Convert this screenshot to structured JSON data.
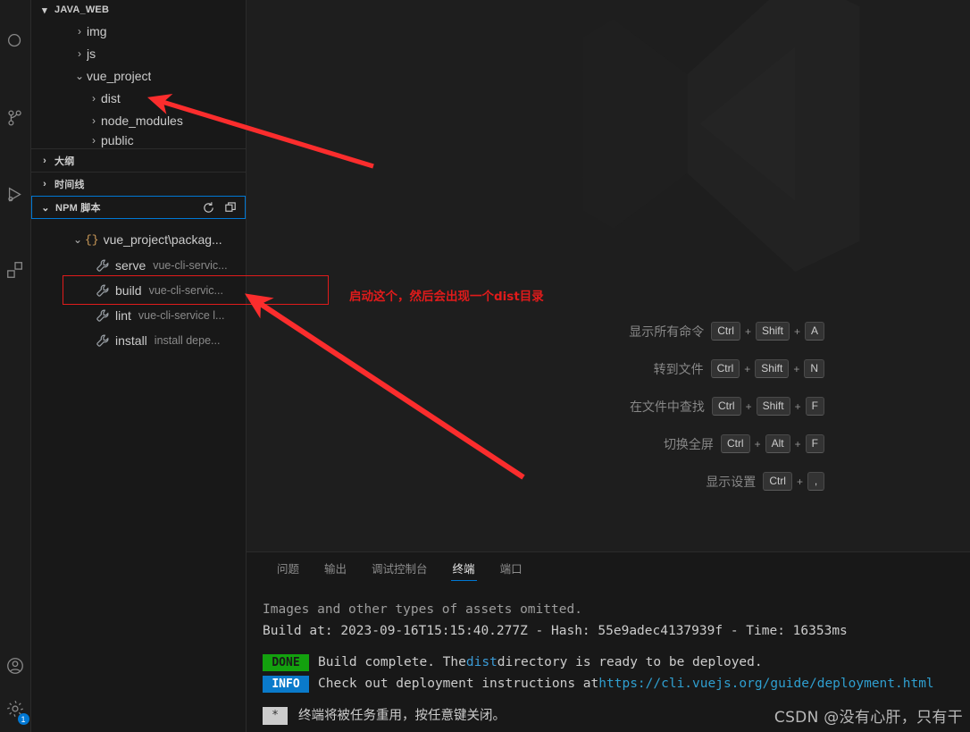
{
  "activity_bar": {
    "items": [
      {
        "name": "search-icon",
        "label": "搜索"
      },
      {
        "name": "source-control-icon",
        "label": "源代码管理"
      },
      {
        "name": "run-debug-icon",
        "label": "运行和调试"
      },
      {
        "name": "extensions-icon",
        "label": "扩展"
      },
      {
        "name": "accounts-icon",
        "label": "账户"
      },
      {
        "name": "settings-gear-icon",
        "label": "管理"
      }
    ],
    "settings_badge": "1"
  },
  "sidebar": {
    "explorer_title": "JAVA_WEB",
    "tree": [
      {
        "label": "img",
        "indent": 1,
        "expanded": false
      },
      {
        "label": "js",
        "indent": 1,
        "expanded": false
      },
      {
        "label": "vue_project",
        "indent": 1,
        "expanded": true
      },
      {
        "label": "dist",
        "indent": 2,
        "expanded": false
      },
      {
        "label": "node_modules",
        "indent": 2,
        "expanded": false
      },
      {
        "label": "public",
        "indent": 2,
        "expanded": false
      }
    ],
    "sections": [
      {
        "label": "大纲",
        "expanded": false
      },
      {
        "label": "时间线",
        "expanded": false
      }
    ],
    "npm": {
      "title": "NPM 脚本",
      "actions": [
        {
          "name": "refresh-icon",
          "label": "刷新"
        },
        {
          "name": "collapse-all-icon",
          "label": "全部折叠"
        }
      ],
      "package_label": "vue_project\\packag...",
      "package_icon": "{}",
      "scripts": [
        {
          "name": "serve",
          "command": "vue-cli-servic..."
        },
        {
          "name": "build",
          "command": "vue-cli-servic..."
        },
        {
          "name": "lint",
          "command": "vue-cli-service l..."
        },
        {
          "name": "install",
          "command": "install depe..."
        }
      ]
    }
  },
  "editor": {
    "logo_name": "vscode-logo-watermark",
    "shortcuts": [
      {
        "label": "显示所有命令",
        "keys": [
          "Ctrl",
          "Shift",
          "A"
        ]
      },
      {
        "label": "转到文件",
        "keys": [
          "Ctrl",
          "Shift",
          "N"
        ]
      },
      {
        "label": "在文件中查找",
        "keys": [
          "Ctrl",
          "Shift",
          "F"
        ]
      },
      {
        "label": "切换全屏",
        "keys": [
          "Ctrl",
          "Alt",
          "F"
        ]
      },
      {
        "label": "显示设置",
        "keys": [
          "Ctrl",
          ","
        ]
      }
    ],
    "key_separator": "+"
  },
  "panel": {
    "tabs": [
      {
        "label": "问题",
        "active": false
      },
      {
        "label": "输出",
        "active": false
      },
      {
        "label": "调试控制台",
        "active": false
      },
      {
        "label": "终端",
        "active": true
      },
      {
        "label": "端口",
        "active": false
      }
    ],
    "terminal": {
      "line_assets": "Images and other types of assets omitted.",
      "line_build_prefix": "Build at: ",
      "build_timestamp": "2023-09-16T15:15:40.277Z",
      "build_sep1": " - Hash: ",
      "build_hash": "55e9adec4137939f",
      "build_sep2": " - Time: ",
      "build_time": "16353ms",
      "done_tag": "DONE",
      "done_text_1": "Build complete. The ",
      "done_dist": "dist",
      "done_text_2": " directory is ready to be deployed.",
      "info_tag": "INFO",
      "info_text": "Check out deployment instructions at ",
      "info_url": "https://cli.vuejs.org/guide/deployment.html",
      "reuse_star": "*",
      "reuse_text": "终端将被任务重用，按任意键关闭。"
    }
  },
  "annotations": {
    "note_build": "启动这个，然后会出现一个dist目录",
    "highlight_color": "#e01b1b"
  },
  "watermark": "CSDN @没有心肝，只有干"
}
